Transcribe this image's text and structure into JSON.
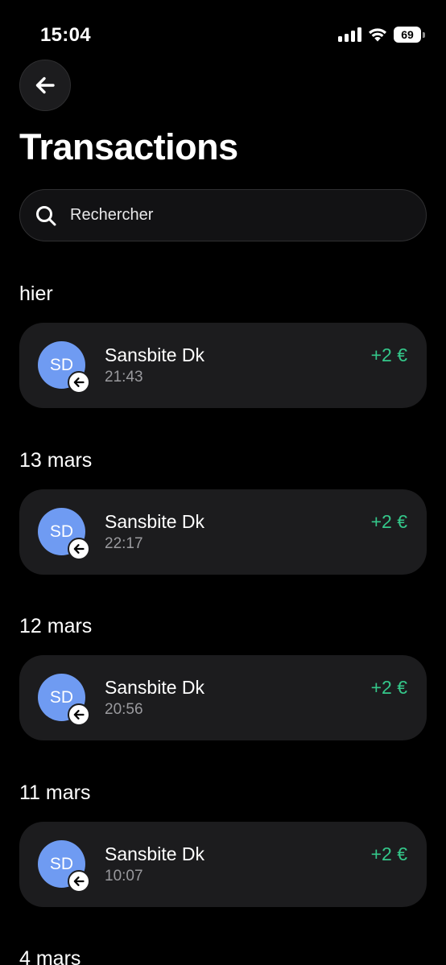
{
  "status_bar": {
    "time": "15:04",
    "battery": "69",
    "icons": [
      "signal-icon",
      "wifi-icon",
      "battery-icon"
    ]
  },
  "header": {
    "back_icon": "arrow-left-icon",
    "title": "Transactions"
  },
  "search": {
    "placeholder": "Rechercher",
    "value": "",
    "icon": "search-icon"
  },
  "colors": {
    "background": "#000000",
    "card": "#1c1c1e",
    "avatar": "#6f9bf2",
    "amount_positive": "#34c78a",
    "secondary_text": "#9a9a9e"
  },
  "sections": [
    {
      "date": "hier",
      "transactions": [
        {
          "initials": "SD",
          "name": "Sansbite Dk",
          "time": "21:43",
          "amount": "+2 €",
          "badge_icon": "arrow-left-icon"
        }
      ]
    },
    {
      "date": "13 mars",
      "transactions": [
        {
          "initials": "SD",
          "name": "Sansbite Dk",
          "time": "22:17",
          "amount": "+2 €",
          "badge_icon": "arrow-left-icon"
        }
      ]
    },
    {
      "date": "12 mars",
      "transactions": [
        {
          "initials": "SD",
          "name": "Sansbite Dk",
          "time": "20:56",
          "amount": "+2 €",
          "badge_icon": "arrow-left-icon"
        }
      ]
    },
    {
      "date": "11 mars",
      "transactions": [
        {
          "initials": "SD",
          "name": "Sansbite Dk",
          "time": "10:07",
          "amount": "+2 €",
          "badge_icon": "arrow-left-icon"
        }
      ]
    },
    {
      "date": "4 mars",
      "transactions": []
    }
  ]
}
